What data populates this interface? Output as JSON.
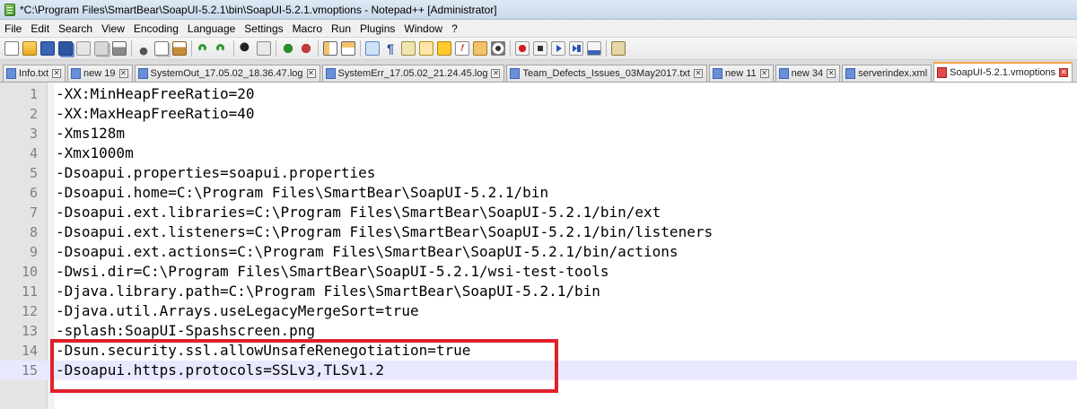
{
  "window": {
    "title": "*C:\\Program Files\\SmartBear\\SoapUI-5.2.1\\bin\\SoapUI-5.2.1.vmoptions - Notepad++ [Administrator]"
  },
  "menu": [
    "File",
    "Edit",
    "Search",
    "View",
    "Encoding",
    "Language",
    "Settings",
    "Macro",
    "Run",
    "Plugins",
    "Window",
    "?"
  ],
  "toolbar_icons": [
    "new-file-icon",
    "open-file-icon",
    "save-icon",
    "save-all-icon",
    "close-icon",
    "close-all-icon",
    "print-icon",
    "cut-icon",
    "copy-icon",
    "paste-icon",
    "undo-icon",
    "redo-icon",
    "find-icon",
    "replace-icon",
    "zoom-in-icon",
    "zoom-out-icon",
    "sync-vertical-icon",
    "sync-horizontal-icon",
    "word-wrap-icon",
    "show-all-chars-icon",
    "indent-guide-icon",
    "user-language-icon",
    "document-map-icon",
    "function-list-icon",
    "folder-workspace-icon",
    "monitoring-icon",
    "record-macro-icon",
    "stop-macro-icon",
    "play-macro-icon",
    "run-macro-multiple-icon",
    "save-macro-icon",
    "plugin-icon"
  ],
  "tabs": [
    {
      "label": "Info.txt",
      "icon_color": "blue",
      "active": false
    },
    {
      "label": "new 19",
      "icon_color": "blue",
      "active": false
    },
    {
      "label": "SystemOut_17.05.02_18.36.47.log",
      "icon_color": "blue",
      "active": false
    },
    {
      "label": "SystemErr_17.05.02_21.24.45.log",
      "icon_color": "blue",
      "active": false
    },
    {
      "label": "Team_Defects_Issues_03May2017.txt",
      "icon_color": "blue",
      "active": false
    },
    {
      "label": "new 11",
      "icon_color": "blue",
      "active": false
    },
    {
      "label": "new 34",
      "icon_color": "blue",
      "active": false
    },
    {
      "label": "serverindex.xml",
      "icon_color": "blue",
      "active": false
    },
    {
      "label": "SoapUI-5.2.1.vmoptions",
      "icon_color": "red",
      "active": true
    }
  ],
  "editor": {
    "current_line": 15,
    "highlight_color": "#e0202a",
    "lines": [
      {
        "num": "1",
        "text": "-XX:MinHeapFreeRatio=20"
      },
      {
        "num": "2",
        "text": "-XX:MaxHeapFreeRatio=40"
      },
      {
        "num": "3",
        "text": "-Xms128m"
      },
      {
        "num": "4",
        "text": "-Xmx1000m"
      },
      {
        "num": "5",
        "text": "-Dsoapui.properties=soapui.properties"
      },
      {
        "num": "6",
        "text": "-Dsoapui.home=C:\\Program Files\\SmartBear\\SoapUI-5.2.1/bin"
      },
      {
        "num": "7",
        "text": "-Dsoapui.ext.libraries=C:\\Program Files\\SmartBear\\SoapUI-5.2.1/bin/ext"
      },
      {
        "num": "8",
        "text": "-Dsoapui.ext.listeners=C:\\Program Files\\SmartBear\\SoapUI-5.2.1/bin/listeners"
      },
      {
        "num": "9",
        "text": "-Dsoapui.ext.actions=C:\\Program Files\\SmartBear\\SoapUI-5.2.1/bin/actions"
      },
      {
        "num": "10",
        "text": "-Dwsi.dir=C:\\Program Files\\SmartBear\\SoapUI-5.2.1/wsi-test-tools"
      },
      {
        "num": "11",
        "text": "-Djava.library.path=C:\\Program Files\\SmartBear\\SoapUI-5.2.1/bin"
      },
      {
        "num": "12",
        "text": "-Djava.util.Arrays.useLegacyMergeSort=true"
      },
      {
        "num": "13",
        "text": "-splash:SoapUI-Spashscreen.png"
      },
      {
        "num": "14",
        "text": "-Dsun.security.ssl.allowUnsafeRenegotiation=true"
      },
      {
        "num": "15",
        "text": "-Dsoapui.https.protocols=SSLv3,TLSv1.2"
      }
    ]
  }
}
